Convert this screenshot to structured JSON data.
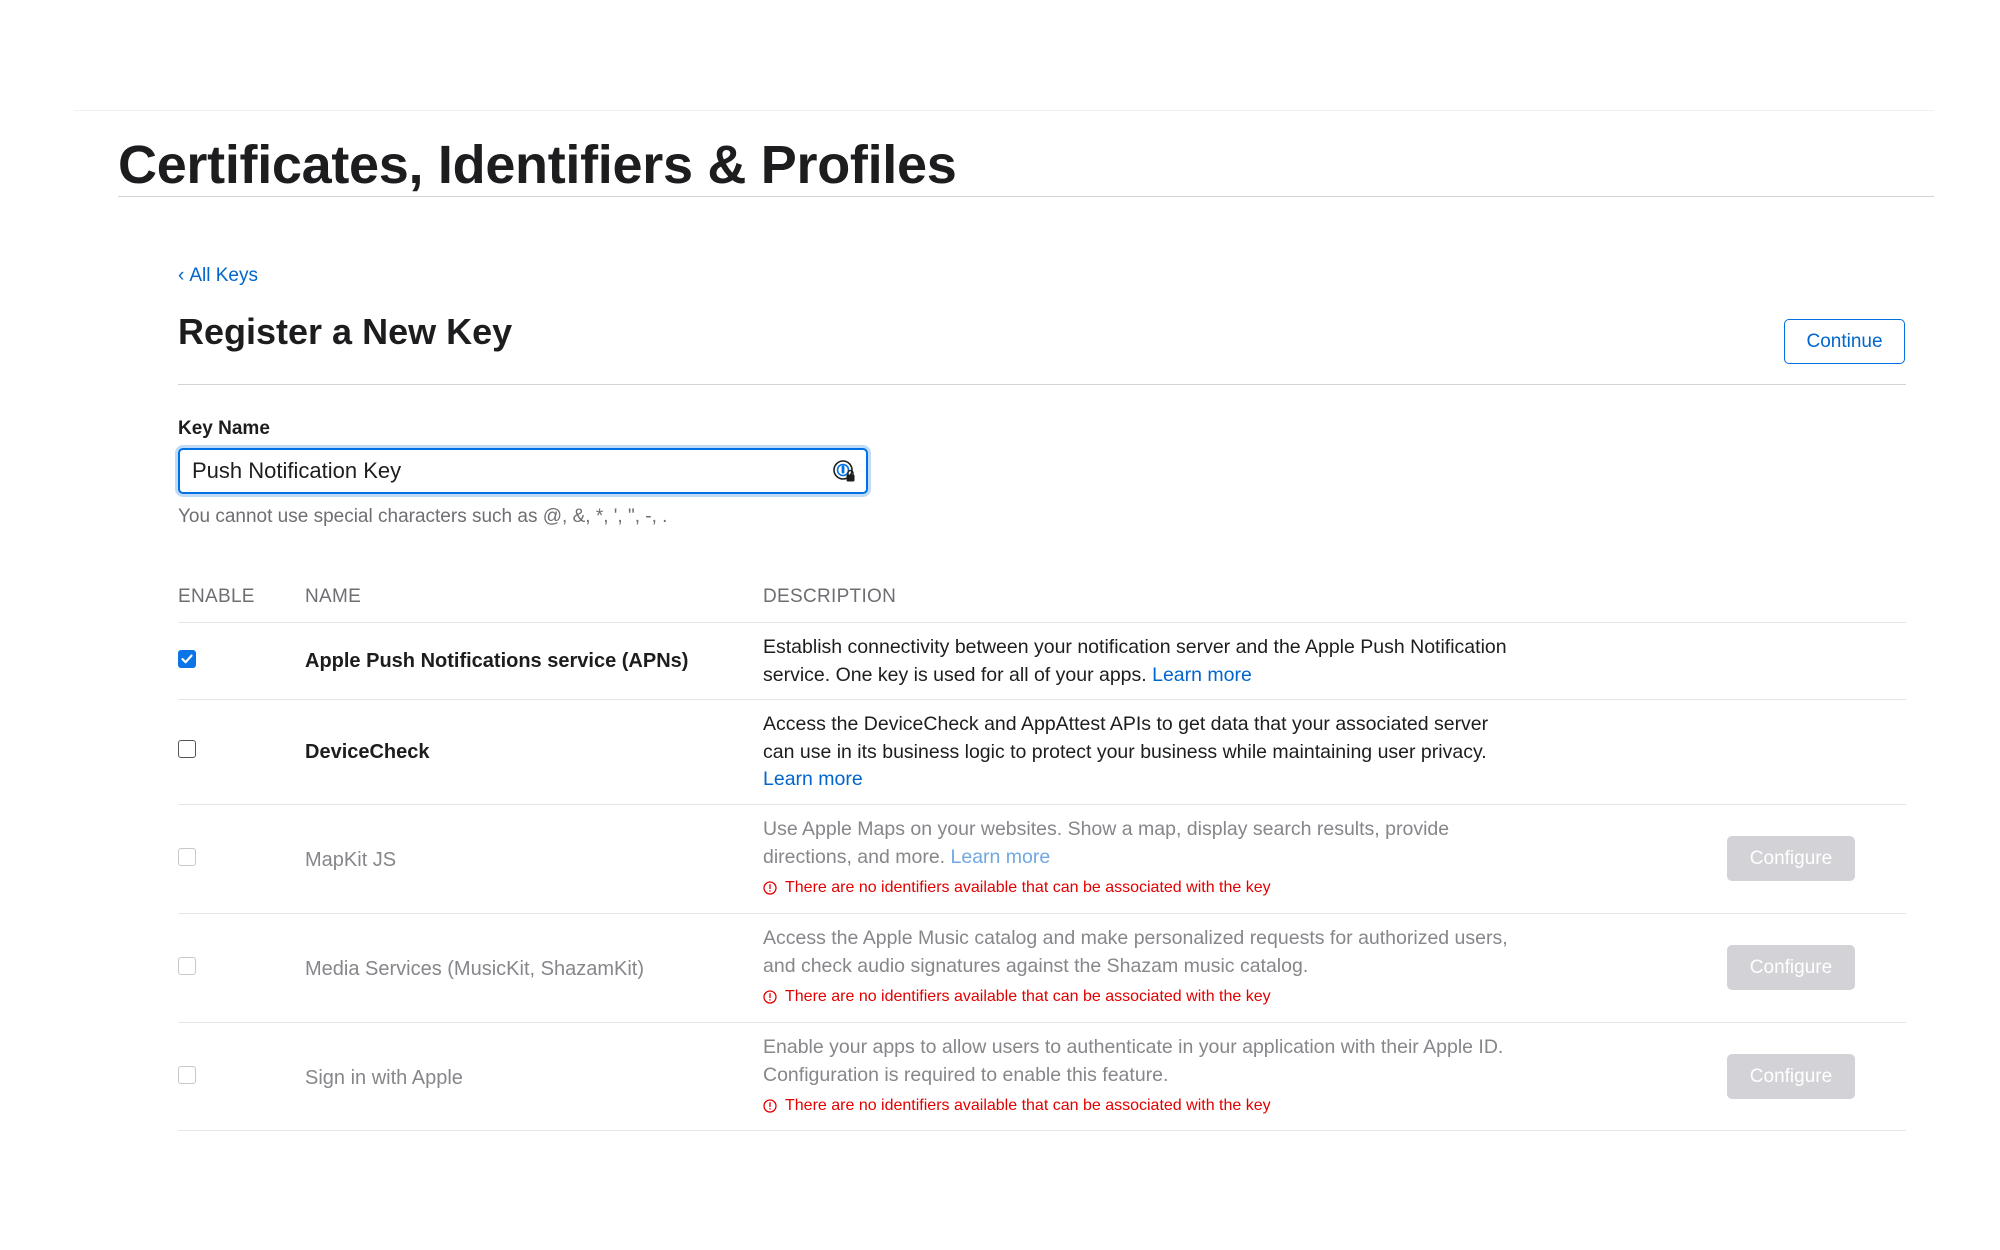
{
  "header": {
    "title": "Certificates, Identifiers & Profiles"
  },
  "back_link": {
    "chevron": "‹",
    "label": "All Keys"
  },
  "section": {
    "title": "Register a New Key",
    "continue_label": "Continue"
  },
  "key_name": {
    "label": "Key Name",
    "value": "Push Notification Key",
    "hint": "You cannot use special characters such as @, &, *, ', \", -, ."
  },
  "table": {
    "headers": {
      "enable": "ENABLE",
      "name": "NAME",
      "description": "DESCRIPTION"
    },
    "warning_text": "There are no identifiers available that can be associated with the key",
    "configure_label": "Configure",
    "rows": [
      {
        "name": "Apple Push Notifications service (APNs)",
        "description": "Establish connectivity between your notification server and the Apple Push Notification service. One key is used for all of your apps.",
        "link": "Learn more",
        "checked": true,
        "enabled": true
      },
      {
        "name": "DeviceCheck",
        "description": "Access the DeviceCheck and AppAttest APIs to get data that your associated server can use in its business logic to protect your business while maintaining user privacy.",
        "link": "Learn more",
        "checked": false,
        "enabled": true
      },
      {
        "name": "MapKit JS",
        "description": "Use Apple Maps on your websites. Show a map, display search results, provide directions, and more.",
        "link": "Learn more",
        "checked": false,
        "enabled": false
      },
      {
        "name": "Media Services (MusicKit, ShazamKit)",
        "description": "Access the Apple Music catalog and make personalized requests for authorized users, and check audio signatures against the Shazam music catalog.",
        "link": "",
        "checked": false,
        "enabled": false
      },
      {
        "name": "Sign in with Apple",
        "description": "Enable your apps to allow users to authenticate in your application with their Apple ID. Configuration is required to enable this feature.",
        "link": "",
        "checked": false,
        "enabled": false
      }
    ]
  },
  "colors": {
    "accent": "#0071e3",
    "link": "#0066cc",
    "warning": "#e30000",
    "disabled_button": "#d2d2d7"
  },
  "icons": {
    "password_manager": "password-key-icon",
    "warning": "warning-circle-icon",
    "checkmark": "checkmark-icon"
  }
}
